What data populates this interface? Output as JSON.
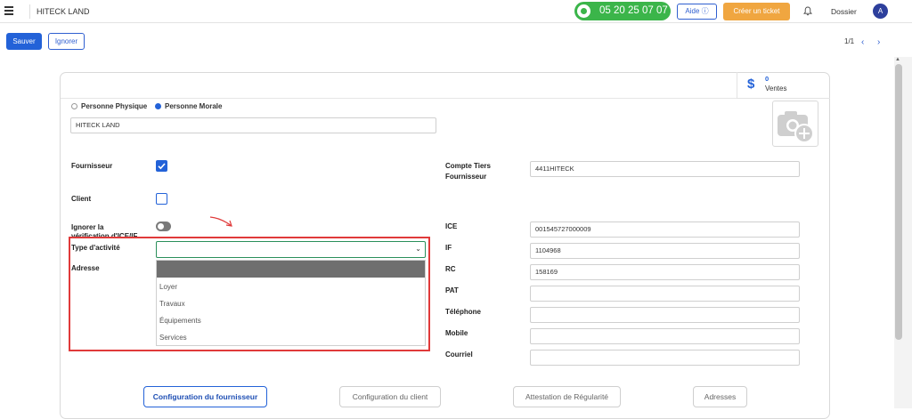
{
  "header": {
    "company": "HITECK LAND",
    "phone": "05 20 25 07 07",
    "help_label": "Aide ⓘ",
    "ticket_label": "Créer un ticket",
    "dossier_label": "Dossier",
    "avatar_letter": "A"
  },
  "toolbar": {
    "save_label": "Sauver",
    "ignore_label": "Ignorer",
    "pager": "1/1",
    "prev_icon": "‹",
    "next_icon": "›"
  },
  "sales": {
    "icon": "$",
    "count": "0",
    "label": "Ventes"
  },
  "form": {
    "type_options": [
      "Personne Physique",
      "Personne Morale"
    ],
    "selected_type": "Personne Morale",
    "name_value": "HITECK LAND",
    "left_labels": {
      "fournisseur": "Fournisseur",
      "client": "Client",
      "ignorer_line1": "Ignorer la",
      "ignorer_line2": "vérification d'ICE/IF",
      "type_activite": "Type d'activité",
      "adresse": "Adresse"
    },
    "fournisseur_checked": true,
    "client_checked": false,
    "ignore_verification": false,
    "activity_options": [
      "Loyer",
      "Travaux",
      "Équipements",
      "Services"
    ],
    "right_fields": {
      "compte_tiers_label_line1": "Compte Tiers",
      "compte_tiers_label_line2": "Fournisseur",
      "compte_tiers_value": "4411HITECK",
      "ice_label": "ICE",
      "ice_value": "001545727000009",
      "if_label": "IF",
      "if_value": "1104968",
      "rc_label": "RC",
      "rc_value": "158169",
      "pat_label": "PAT",
      "pat_value": "",
      "telephone_label": "Téléphone",
      "telephone_value": "",
      "mobile_label": "Mobile",
      "mobile_value": "",
      "courriel_label": "Courriel",
      "courriel_value": ""
    }
  },
  "tabs": [
    "Configuration du fournisseur",
    "Configuration du client",
    "Attestation de Régularité",
    "Adresses"
  ],
  "active_tab": "Configuration du fournisseur",
  "colors": {
    "primary": "#2362d8",
    "phone_green": "#3bb54a",
    "ticket_orange": "#f0a640",
    "highlight_red": "#e03a3a"
  }
}
